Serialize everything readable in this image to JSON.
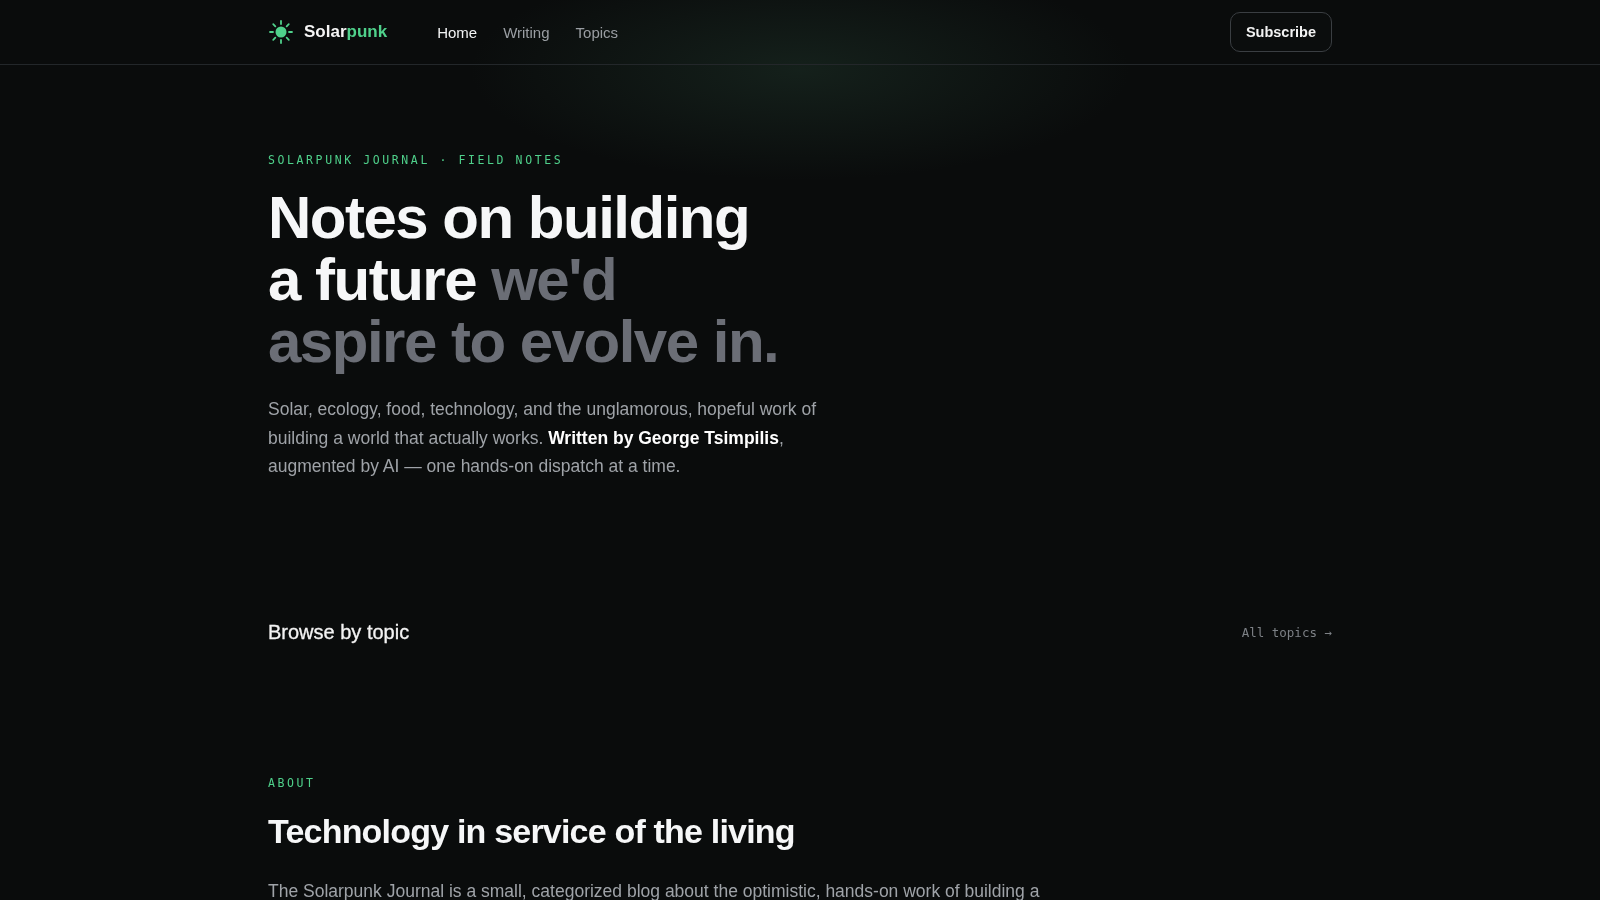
{
  "header": {
    "brand": {
      "text": "Solar",
      "accent": "punk"
    },
    "nav": [
      {
        "label": "Home",
        "selected": true
      },
      {
        "label": "Writing",
        "selected": false
      },
      {
        "label": "Topics",
        "selected": false
      }
    ],
    "subscribe": "Subscribe"
  },
  "hero": {
    "eyebrow": "SOLARPUNK JOURNAL · FIELD NOTES",
    "headline": [
      {
        "text": "Notes on building a future",
        "muted": false
      },
      {
        "text": "we'd aspire to evolve in.",
        "muted": true
      }
    ],
    "intro": "Solar, ecology, food, technology, and the unglamorous, hopeful work of building a world that actually works. **Written by George Tsimpilis**, augmented by AI — one hands-on dispatch at a time."
  },
  "topics": {
    "title": "Browse by topic",
    "link": "All topics →"
  },
  "about": {
    "eyebrow": "ABOUT",
    "title": "Technology in service of the living",
    "text": "The Solarpunk Journal is a small, categorized blog about the optimistic, hands-on work of building a"
  }
}
